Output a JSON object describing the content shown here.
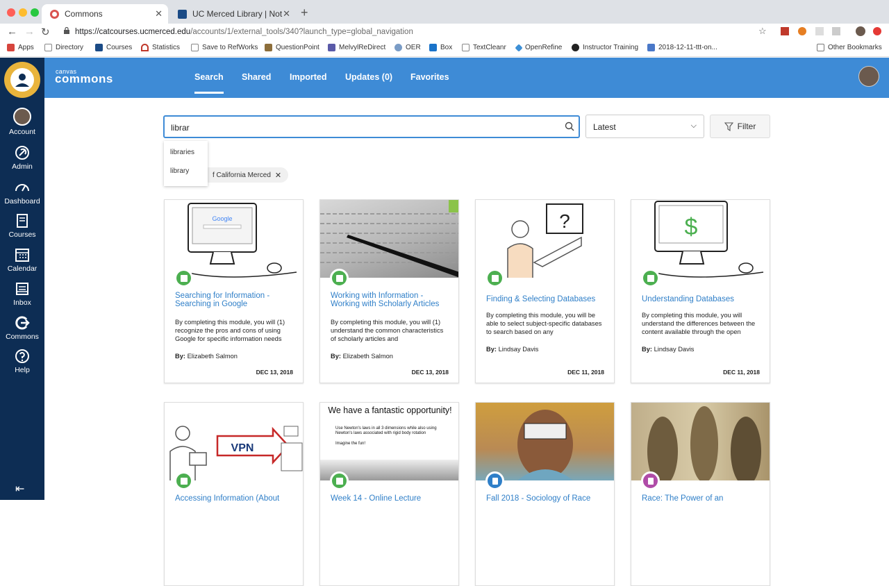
{
  "browser": {
    "tabs": [
      {
        "title": "Commons",
        "active": true
      },
      {
        "title": "UC Merced Library | Not what",
        "active": false
      }
    ],
    "url_host": "https://catcourses.ucmerced.edu",
    "url_path": "/accounts/1/external_tools/340?launch_type=global_navigation",
    "bookmarks": [
      "Apps",
      "Directory",
      "Courses",
      "Statistics",
      "Save to RefWorks",
      "QuestionPoint",
      "MelvylReDirect",
      "OER",
      "Box",
      "TextCleanr",
      "OpenRefine",
      "Instructor Training",
      "2018-12-11-ttt-on...",
      "Other Bookmarks"
    ]
  },
  "sidebar": {
    "items": [
      {
        "label": "Account",
        "icon": "avatar-icon"
      },
      {
        "label": "Admin",
        "icon": "admin-icon"
      },
      {
        "label": "Dashboard",
        "icon": "dashboard-icon"
      },
      {
        "label": "Courses",
        "icon": "courses-icon"
      },
      {
        "label": "Calendar",
        "icon": "calendar-icon"
      },
      {
        "label": "Inbox",
        "icon": "inbox-icon"
      },
      {
        "label": "Commons",
        "icon": "commons-icon"
      },
      {
        "label": "Help",
        "icon": "help-icon"
      }
    ]
  },
  "header": {
    "brand_small": "canvas",
    "brand_big": "commons",
    "nav": [
      "Search",
      "Shared",
      "Imported",
      "Updates (0)",
      "Favorites"
    ]
  },
  "search": {
    "value": "librar",
    "suggestions": [
      "libraries",
      "library"
    ],
    "sort": "Latest",
    "filter_label": "Filter",
    "chip": "f California Merced"
  },
  "cards": [
    {
      "title": "Searching for Information - Searching in Google",
      "desc": "By completing this module, you will (1) recognize the pros and cons of using Google for specific information needs",
      "by": "By:",
      "author": "Elizabeth Salmon",
      "date": "DEC 13, 2018",
      "badge_color": "#4caf50"
    },
    {
      "title": "Working with Information - Working with Scholarly Articles",
      "desc": "By completing this module, you will (1) understand the common characteristics of scholarly articles and",
      "by": "By:",
      "author": "Elizabeth Salmon",
      "date": "DEC 13, 2018",
      "badge_color": "#4caf50"
    },
    {
      "title": "Finding & Selecting Databases",
      "desc": "By completing this module, you will be able to select subject-specific databases to search based on any",
      "by": "By:",
      "author": "Lindsay Davis",
      "date": "DEC 11, 2018",
      "badge_color": "#4caf50"
    },
    {
      "title": "Understanding Databases",
      "desc": "By completing this module, you will understand the differences between the content available through the open",
      "by": "By:",
      "author": "Lindsay Davis",
      "date": "DEC 11, 2018",
      "badge_color": "#4caf50"
    },
    {
      "title": "Accessing Information (About",
      "desc": "",
      "by": "",
      "author": "",
      "date": "",
      "badge_color": "#4caf50"
    },
    {
      "title": "Week 14 - Online Lecture",
      "desc": "",
      "by": "",
      "author": "",
      "date": "",
      "badge_color": "#4caf50"
    },
    {
      "title": "Fall 2018 - Sociology of Race",
      "desc": "",
      "by": "",
      "author": "",
      "date": "",
      "badge_color": "#2f7fc8"
    },
    {
      "title": "Race: The Power of an",
      "desc": "",
      "by": "",
      "author": "",
      "date": "",
      "badge_color": "#b04ca8"
    }
  ],
  "thumb_text": {
    "google": "Google",
    "dollar": "$",
    "question": "?",
    "vpn": "VPN",
    "slide_title": "We have a fantastic opportunity!",
    "slide_bullets": [
      "Use Newton's laws in all 3 dimensions while also using Newton's laws associated with rigid body rotation",
      "Imagine the fun!"
    ]
  }
}
